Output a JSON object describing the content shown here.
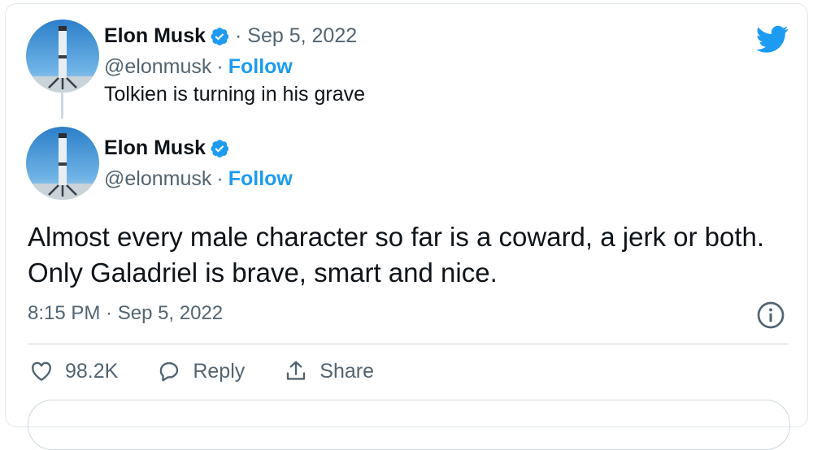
{
  "quoted": {
    "name": "Elon Musk",
    "date": "· Sep 5, 2022",
    "handle": "@elonmusk",
    "separator": "·",
    "follow_label": "Follow",
    "text": "Tolkien is turning in his grave"
  },
  "tweet": {
    "name": "Elon Musk",
    "handle": "@elonmusk",
    "separator": "·",
    "follow_label": "Follow",
    "text": "Almost every male character so far is a coward, a jerk or both. Only Galadriel is brave, smart and nice.",
    "timestamp": "8:15 PM · Sep 5, 2022"
  },
  "actions": {
    "like_count": "98.2K",
    "reply_label": "Reply",
    "share_label": "Share"
  },
  "icons": {
    "brand": "twitter-bird-icon",
    "verified": "verified-badge-icon",
    "info": "info-icon",
    "like": "heart-icon",
    "reply": "reply-icon",
    "share": "share-icon"
  },
  "colors": {
    "brand": "#1d9bf0",
    "text": "#0f1419",
    "muted": "#536471",
    "border": "#cfd9de"
  }
}
